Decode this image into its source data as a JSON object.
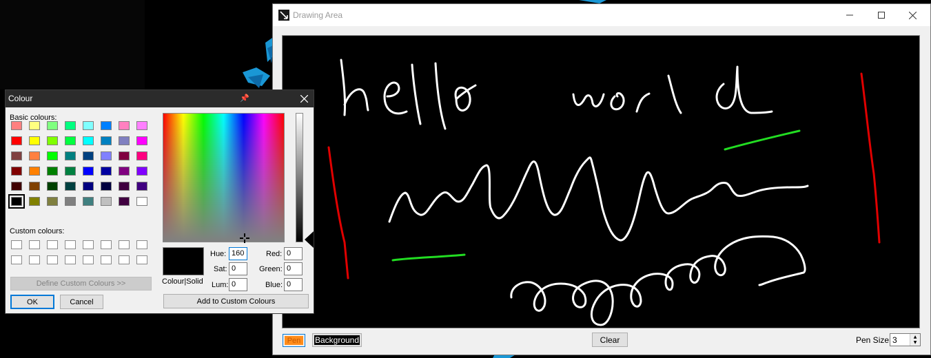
{
  "drawing_window": {
    "title": "Drawing Area",
    "canvas_text": "hello world",
    "pen_label": "Pen",
    "background_label": "Background",
    "clear_label": "Clear",
    "pen_size_label": "Pen Size",
    "pen_size_value": "3"
  },
  "colour_dialog": {
    "title": "Colour",
    "basic_colours_label": "Basic colours:",
    "custom_colours_label": "Custom colours:",
    "define_custom_label": "Define Custom Colours >>",
    "ok_label": "OK",
    "cancel_label": "Cancel",
    "add_custom_label": "Add to Custom Colours",
    "colour_solid_label": "Colour|Solid",
    "hue_label": "Hue:",
    "sat_label": "Sat:",
    "lum_label": "Lum:",
    "red_label": "Red:",
    "green_label": "Green:",
    "blue_label": "Blue:",
    "hue": "160",
    "sat": "0",
    "lum": "0",
    "red": "0",
    "green": "0",
    "blue": "0",
    "basic_colours": [
      [
        "#ff8080",
        "#ffff80",
        "#80ff80",
        "#00ff80",
        "#80ffff",
        "#0080ff",
        "#ff80c0",
        "#ff80ff"
      ],
      [
        "#ff0000",
        "#ffff00",
        "#80ff00",
        "#00ff40",
        "#00ffff",
        "#0080c0",
        "#8080c0",
        "#ff00ff"
      ],
      [
        "#804040",
        "#ff8040",
        "#00ff00",
        "#008080",
        "#004080",
        "#8080ff",
        "#800040",
        "#ff0080"
      ],
      [
        "#800000",
        "#ff8000",
        "#008000",
        "#008040",
        "#0000ff",
        "#0000a0",
        "#800080",
        "#8000ff"
      ],
      [
        "#400000",
        "#804000",
        "#004000",
        "#004040",
        "#000080",
        "#000040",
        "#400040",
        "#400080"
      ],
      [
        "#000000",
        "#808000",
        "#808040",
        "#808080",
        "#408080",
        "#c0c0c0",
        "#400040",
        "#ffffff"
      ]
    ],
    "selected_colour": "#000000"
  },
  "colors": {
    "pen": "#ff8c1a",
    "accent": "#0078d7",
    "stroke_white": "#ffffff",
    "stroke_red": "#e00000",
    "stroke_green": "#22dd22"
  }
}
